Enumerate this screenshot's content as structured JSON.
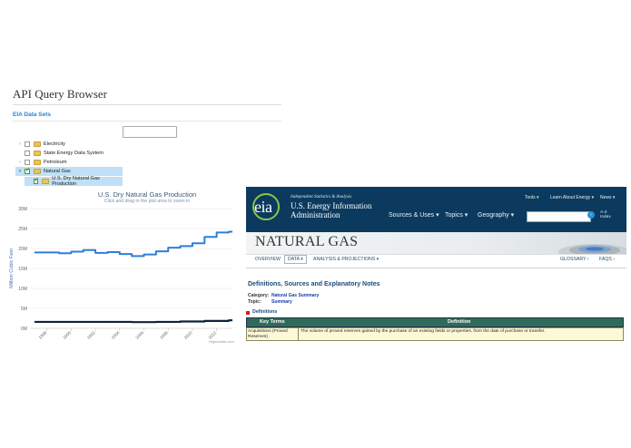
{
  "api_browser": {
    "title": "API Query Browser",
    "section": "EIA Data Sets",
    "search_value": "",
    "tree": [
      {
        "label": "Electricity",
        "checked": false,
        "toggle": "›"
      },
      {
        "label": "State Energy Data System",
        "checked": false,
        "toggle": ""
      },
      {
        "label": "Petroleum",
        "checked": false,
        "toggle": "›"
      },
      {
        "label": "Natural Gas",
        "checked": true,
        "toggle": "▾",
        "selected": true
      },
      {
        "label": "U.S. Dry Natural Gas Production",
        "checked": true,
        "toggle": "",
        "selected": true
      }
    ]
  },
  "chart_data": {
    "type": "line",
    "title": "U.S. Dry Natural Gas Production",
    "subtitle": "Click and drag in the plot area to zoom in",
    "ylabel": "Million Cubic Feet",
    "xlabel": "",
    "ylim": [
      0,
      30000000
    ],
    "yticks": [
      "0M",
      "5M",
      "10M",
      "15M",
      "20M",
      "25M",
      "30M"
    ],
    "xticks": [
      "1998",
      "2000",
      "2002",
      "2004",
      "2006",
      "2008",
      "2010",
      "2012"
    ],
    "credit": "Highcharts.com",
    "colors": {
      "annual": "#2f7ed8",
      "monthly": "#0d233a"
    },
    "series": [
      {
        "x": [
          1997,
          1998,
          1999,
          2000,
          2001,
          2002,
          2003,
          2004,
          2005,
          2006,
          2007,
          2008,
          2009,
          2010,
          2011,
          2012,
          2013
        ],
        "values": [
          19000000,
          19000000,
          18800000,
          19200000,
          19600000,
          18900000,
          19100000,
          18600000,
          18100000,
          18500000,
          19300000,
          20200000,
          20600000,
          21300000,
          22900000,
          24000000,
          24200000
        ]
      },
      {
        "x": [
          1997,
          1999,
          2001,
          2003,
          2005,
          2007,
          2009,
          2011,
          2013
        ],
        "values": [
          1600000,
          1600000,
          1600000,
          1600000,
          1550000,
          1600000,
          1700000,
          1850000,
          2000000
        ]
      }
    ]
  },
  "eia": {
    "tagline": "Independent Statistics & Analysis",
    "org_line1": "U.S. Energy Information",
    "org_line2": "Administration",
    "logo": "eia",
    "topnav": [
      "Tools ▾",
      "Learn About Energy ▾",
      "News ▾"
    ],
    "mainnav": [
      "Sources & Uses ▾",
      "Topics ▾",
      "Geography ▾"
    ],
    "search_placeholder": "",
    "az_line1": "A-Z",
    "az_line2": "Index",
    "page_title": "NATURAL GAS",
    "tabs": [
      "OVERVIEW",
      "DATA ▾",
      "ANALYSIS & PROJECTIONS ▾"
    ],
    "right_tabs": [
      "GLOSSARY ›",
      "FAQS ›"
    ],
    "section_title": "Definitions, Sources and Explanatory Notes",
    "category_label": "Category:",
    "category_value": "Natural Gas Summary",
    "topic_label": "Topic:",
    "topic_value": "Summary",
    "defs_label": "Definitions",
    "table": {
      "headers": [
        "Key Terms",
        "Definition"
      ],
      "row_term_1": "Acquisitions (Proved",
      "row_term_2": "Reserves)",
      "row_def": "The volume of proved reserves gained by the purchase of an existing fields or properties, from the date of purchase or transfer."
    }
  }
}
